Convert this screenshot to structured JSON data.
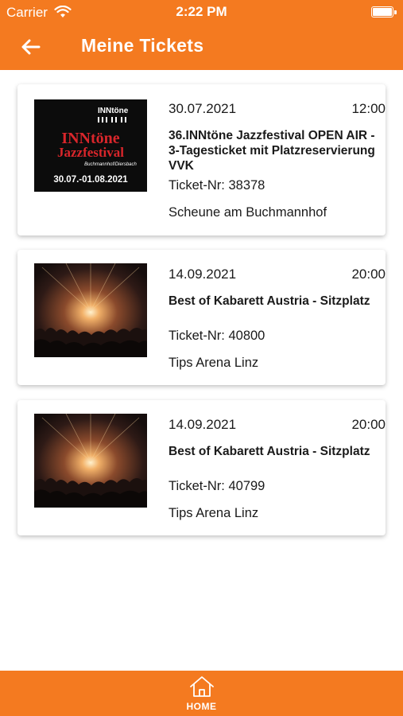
{
  "status": {
    "carrier": "Carrier",
    "time": "2:22 PM"
  },
  "header": {
    "title": "Meine Tickets"
  },
  "tickets": [
    {
      "date": "30.07.2021",
      "time": "12:00",
      "title": "36.INNtöne Jazzfestival OPEN AIR - 3-Tagesticket mit Platzreservierung VVK",
      "ticket_nr": "Ticket-Nr: 38378",
      "venue": "Scheune am Buchmannhof",
      "poster": {
        "brand": "INNtöne",
        "line1": "INNtöne",
        "line2": "Jazzfestival",
        "sub": "Buchmannhof/Diersbach",
        "dates": "30.07.-01.08.2021"
      }
    },
    {
      "date": "14.09.2021",
      "time": "20:00",
      "title": "Best of Kabarett Austria - Sitzplatz",
      "ticket_nr": "Ticket-Nr: 40800",
      "venue": "Tips Arena Linz"
    },
    {
      "date": "14.09.2021",
      "time": "20:00",
      "title": "Best of Kabarett Austria - Sitzplatz",
      "ticket_nr": "Ticket-Nr: 40799",
      "venue": "Tips Arena Linz"
    }
  ],
  "tabbar": {
    "home_label": "HOME"
  },
  "colors": {
    "accent": "#f47a20",
    "text": "#1a1a1a",
    "white": "#ffffff"
  }
}
